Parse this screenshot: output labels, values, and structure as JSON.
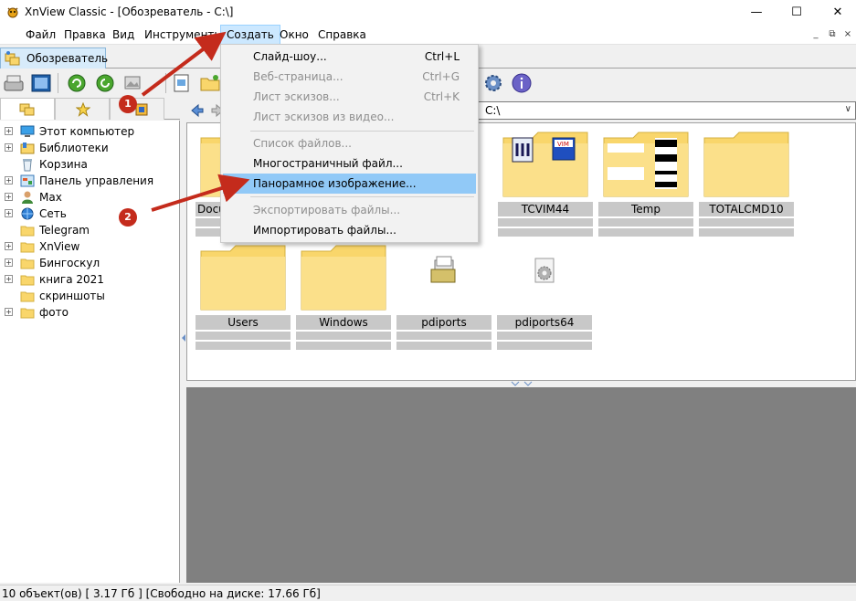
{
  "window": {
    "title": "XnView Classic - [Обозреватель - C:\\]",
    "minimize_glyph": "—",
    "maximize_glyph": "☐",
    "close_glyph": "✕"
  },
  "menu": {
    "items": [
      "Файл",
      "Правка",
      "Вид",
      "Инструменты",
      "Создать",
      "Окно",
      "Справка"
    ],
    "active_item": "Создать",
    "mdi_buttons": [
      "_",
      "⧉",
      "×"
    ]
  },
  "tab": {
    "label": "Обозреватель"
  },
  "navigation": {
    "path": "C:\\",
    "dropdown_glyph": "∨"
  },
  "tree": {
    "items": [
      {
        "label": "Этот компьютер",
        "icon": "computer-icon",
        "expandable": true
      },
      {
        "label": "Библиотеки",
        "icon": "library-icon",
        "expandable": true
      },
      {
        "label": "Корзина",
        "icon": "recycle-bin-icon",
        "expandable": false
      },
      {
        "label": "Панель управления",
        "icon": "control-panel-icon",
        "expandable": true
      },
      {
        "label": "Max",
        "icon": "user-icon",
        "expandable": true
      },
      {
        "label": "Сеть",
        "icon": "network-icon",
        "expandable": true
      },
      {
        "label": "Telegram",
        "icon": "folder-icon",
        "expandable": false
      },
      {
        "label": "XnView",
        "icon": "folder-icon",
        "expandable": true
      },
      {
        "label": "Бингоскул",
        "icon": "folder-icon",
        "expandable": true
      },
      {
        "label": "книга 2021",
        "icon": "folder-icon",
        "expandable": true
      },
      {
        "label": "скриншоты",
        "icon": "folder-icon",
        "expandable": false
      },
      {
        "label": "фото",
        "icon": "folder-icon",
        "expandable": true
      }
    ]
  },
  "thumbnails": [
    {
      "name": "Docu",
      "kind": "folder"
    },
    {
      "name": "TCVIM44",
      "kind": "folder-vim"
    },
    {
      "name": "Temp",
      "kind": "folder-docs"
    },
    {
      "name": "TOTALCMD10",
      "kind": "folder"
    },
    {
      "name": "Users",
      "kind": "folder"
    },
    {
      "name": "Windows",
      "kind": "folder"
    },
    {
      "name": "pdiports",
      "kind": "file-printer"
    },
    {
      "name": "pdiports64",
      "kind": "file-gear"
    }
  ],
  "create_menu": {
    "items": [
      {
        "label": "Слайд-шоу...",
        "shortcut": "Ctrl+L",
        "enabled": true,
        "highlighted": false
      },
      {
        "label": "Веб-страница...",
        "shortcut": "Ctrl+G",
        "enabled": false,
        "highlighted": false
      },
      {
        "label": "Лист эскизов...",
        "shortcut": "Ctrl+K",
        "enabled": false,
        "highlighted": false
      },
      {
        "label": "Лист эскизов из видео...",
        "shortcut": "",
        "enabled": false,
        "highlighted": false
      },
      {
        "label": "Список файлов...",
        "shortcut": "",
        "enabled": false,
        "highlighted": false
      },
      {
        "label": "Многостраничный файл...",
        "shortcut": "",
        "enabled": true,
        "highlighted": false
      },
      {
        "label": "Панорамное изображение...",
        "shortcut": "",
        "enabled": true,
        "highlighted": true
      },
      {
        "label": "Экспортировать файлы...",
        "shortcut": "",
        "enabled": false,
        "highlighted": false
      },
      {
        "label": "Импортировать файлы...",
        "shortcut": "",
        "enabled": true,
        "highlighted": false
      }
    ]
  },
  "status": {
    "text": "10 объект(ов) [ 3.17 Гб ] [Свободно на диске: 17.66 Гб]"
  },
  "annotations": {
    "badges": [
      "1",
      "2"
    ],
    "color": "#c42b1c"
  },
  "colors": {
    "menu_highlight": "#91c9f7",
    "active_menu": "#cce8ff",
    "folder": "#f9d66b",
    "preview_bg": "#808080"
  }
}
